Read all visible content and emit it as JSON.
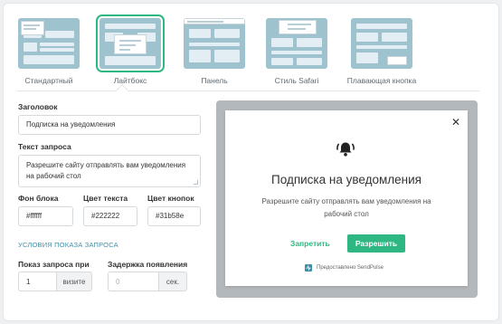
{
  "tabs": [
    {
      "label": "Стандартный",
      "active": false
    },
    {
      "label": "Лайтбокс",
      "active": true
    },
    {
      "label": "Панель",
      "active": false
    },
    {
      "label": "Стиль Safari",
      "active": false
    },
    {
      "label": "Плавающая кнопка",
      "active": false
    }
  ],
  "form": {
    "title_label": "Заголовок",
    "title_value": "Подписка на уведомления",
    "request_label": "Текст запроса",
    "request_value": "Разрешите сайту  отправлять вам уведомления на рабочий стол",
    "bg_label": "Фон блока",
    "bg_value": "#ffffff",
    "text_color_label": "Цвет текста",
    "text_color_value": "#222222",
    "button_color_label": "Цвет кнопок",
    "button_color_value": "#31b58e",
    "conditions_title": "Условия показа запроса",
    "show_label": "Показ запроса при",
    "show_value": "1",
    "show_suffix": "визите",
    "delay_label": "Задержка появления",
    "delay_placeholder": "0",
    "delay_suffix": "сек."
  },
  "preview": {
    "close": "✕",
    "title": "Подписка на уведомления",
    "text": "Разрешите сайту отправлять вам уведомления на рабочий стол",
    "deny": "Запретить",
    "allow": "Разрешить",
    "powered": "Предоставлено SendPulse"
  },
  "colors": {
    "accent": "#2fb783",
    "thumb_bg": "#9fc2cf",
    "preview_bg": "#b3b8bc"
  }
}
